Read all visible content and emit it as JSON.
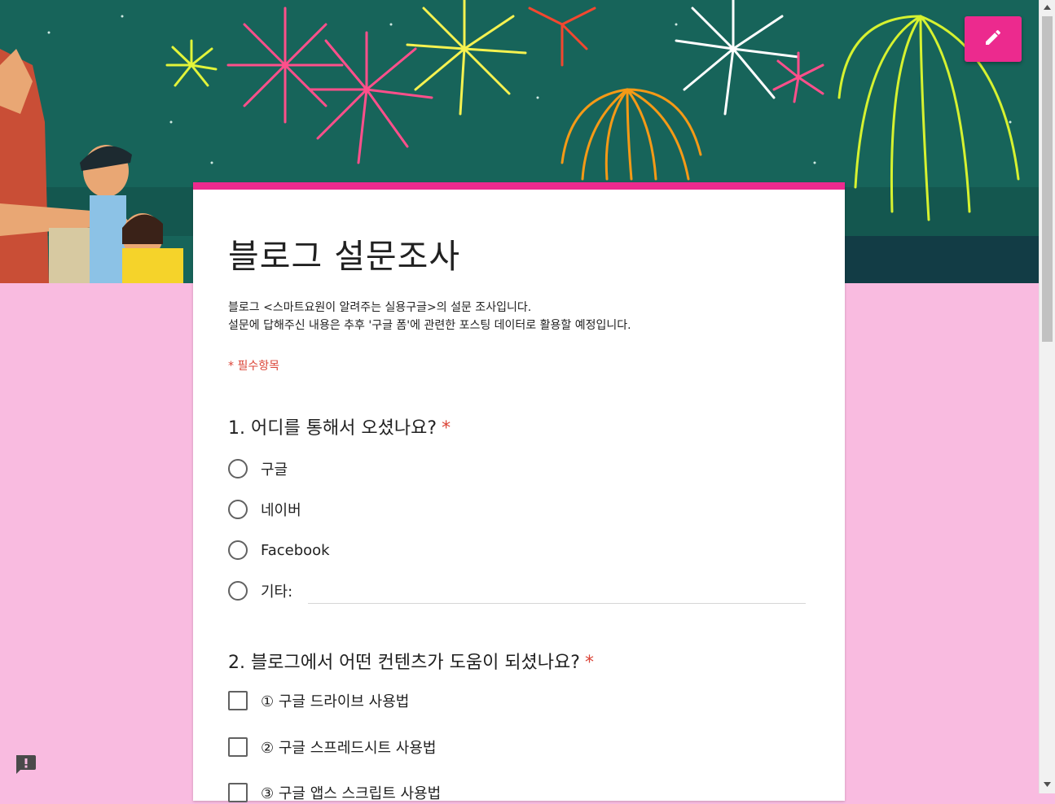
{
  "form": {
    "title": "블로그 설문조사",
    "description": [
      "블로그 <스마트요원이 알려주는 실용구글>의 설문 조사입니다.",
      "설문에 답해주신 내용은 추후 '구글 폼'에 관련한 포스팅 데이터로 활용할 예정입니다."
    ],
    "required_note": "* 필수항목"
  },
  "questions": [
    {
      "title": "1. 어디를 통해서 오셨나요?",
      "required_mark": "*",
      "type": "radio",
      "options": [
        "구글",
        "네이버",
        "Facebook",
        "기타:"
      ]
    },
    {
      "title": "2. 블로그에서 어떤 컨텐츠가 도움이 되셨나요?",
      "required_mark": "*",
      "type": "checkbox",
      "options": [
        "① 구글 드라이브 사용법",
        "② 구글 스프레드시트 사용법",
        "③ 구글 앱스 스크립트 사용법"
      ]
    }
  ],
  "icons": {
    "edit": "pencil-icon",
    "report": "feedback-icon"
  },
  "colors": {
    "accent": "#ec2a8e",
    "background": "#f9bbe0",
    "required": "#db4437",
    "banner_sky": "#17645a"
  }
}
